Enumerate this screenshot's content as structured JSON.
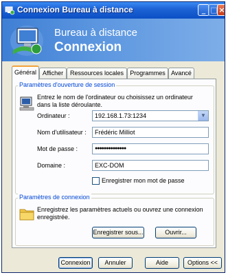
{
  "window": {
    "title": "Connexion Bureau à distance",
    "controls": {
      "minimize": "_",
      "maximize": "□",
      "close": "×"
    }
  },
  "banner": {
    "line1": "Bureau à distance",
    "line2": "Connexion",
    "icon": "remote-desktop-logo"
  },
  "tabs": [
    {
      "label": "Général",
      "active": true
    },
    {
      "label": "Afficher"
    },
    {
      "label": "Ressources locales"
    },
    {
      "label": "Programmes"
    },
    {
      "label": "Avancé"
    }
  ],
  "session": {
    "legend": "Paramètres d'ouverture de session",
    "icon": "computer-icon",
    "description": "Entrez le nom de l'ordinateur ou choisissez un ordinateur dans la liste déroulante.",
    "computer_label": "Ordinateur :",
    "computer_value": "192.168.1.73:1234",
    "user_label": "Nom d'utilisateur :",
    "user_value": "Frédéric Milliot",
    "password_label": "Mot de passe :",
    "password_value": "●●●●●●●●●●●●●●",
    "domain_label": "Domaine :",
    "domain_value": "EXC-DOM",
    "save_password_label": "Enregistrer mon mot de passe",
    "save_password_checked": false
  },
  "connection": {
    "legend": "Paramètres de connexion",
    "icon": "folder-icon",
    "description": "Enregistrez les paramètres actuels ou ouvrez une connexion enregistrée.",
    "save_as_label": "Enregistrer sous...",
    "open_label": "Ouvrir..."
  },
  "footer": {
    "connect_label": "Connexion",
    "cancel_label": "Annuler",
    "help_label": "Aide",
    "options_label": "Options <<"
  }
}
